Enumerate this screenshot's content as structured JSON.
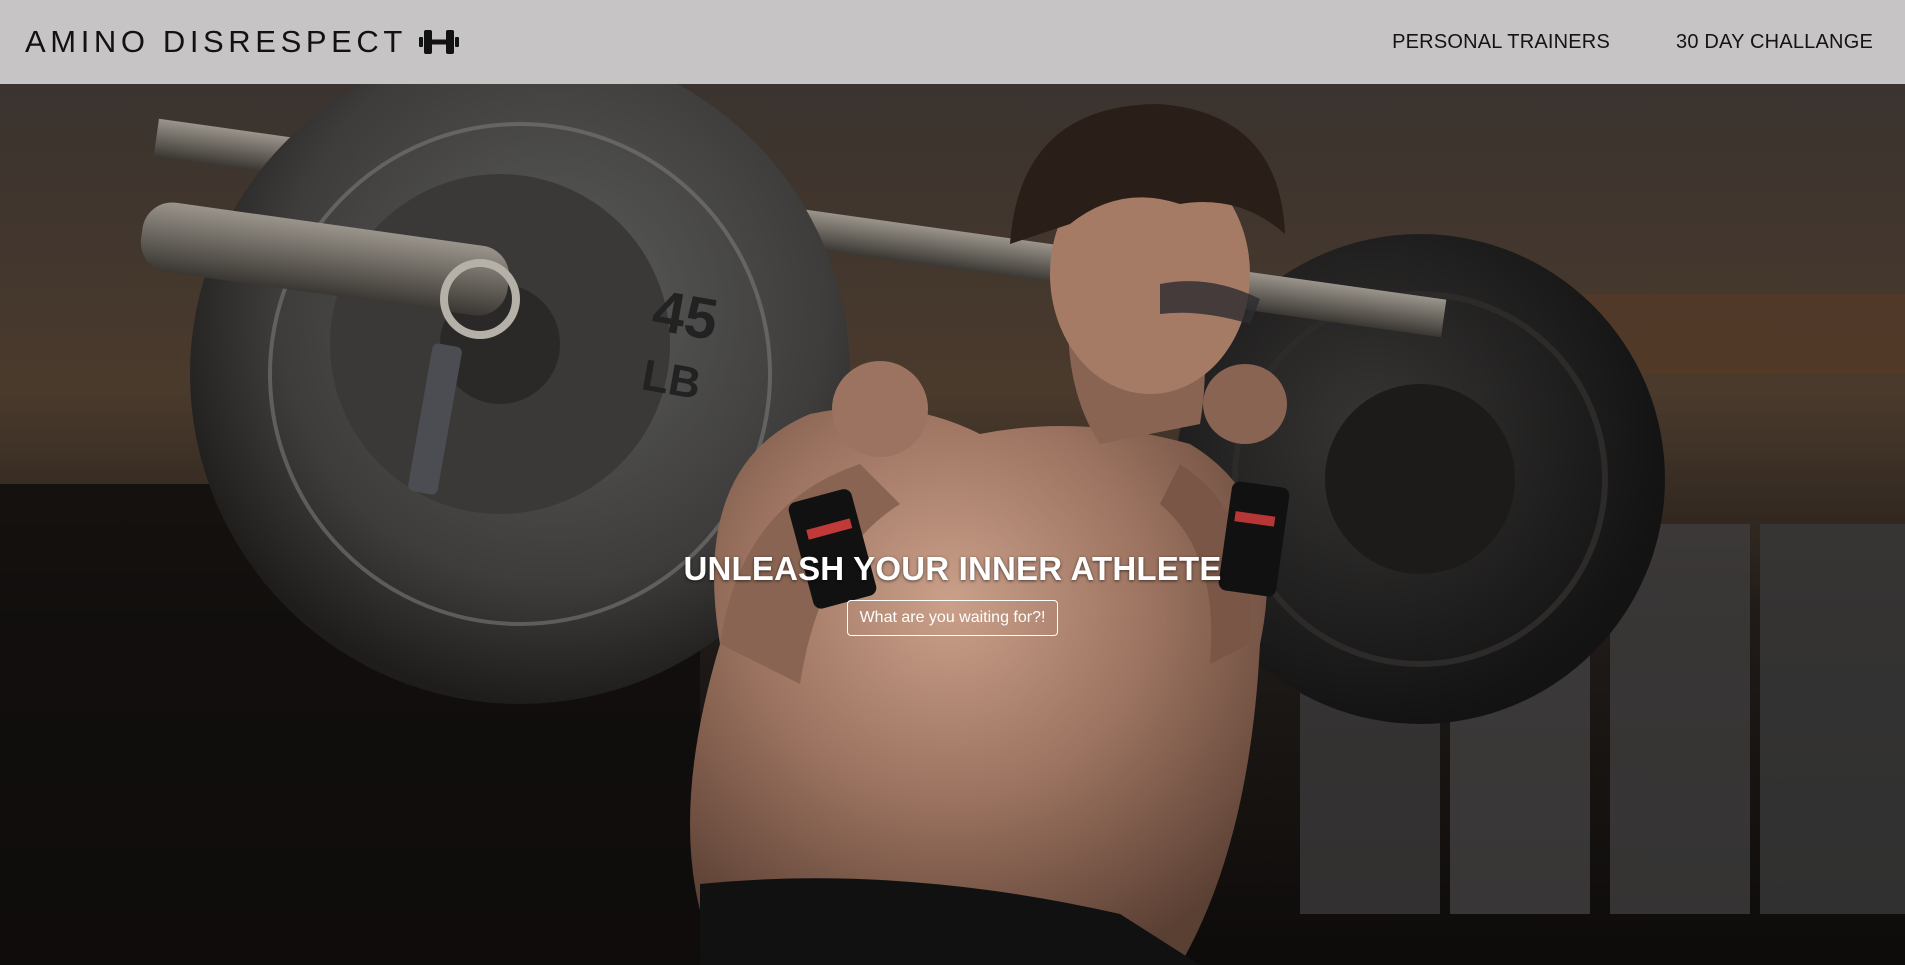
{
  "navbar": {
    "brand_text": "AMINO DISRESPECT",
    "brand_icon": "dumbbell-icon",
    "links": [
      {
        "label": "PERSONAL TRAINERS"
      },
      {
        "label": "30 DAY CHALLANGE"
      }
    ],
    "background_color": "#c6c4c4"
  },
  "hero": {
    "title": "UNLEASH YOUR INNER ATHLETE",
    "button_label": "What are you waiting for?!",
    "plate_label": "45",
    "plate_unit": "LB"
  }
}
